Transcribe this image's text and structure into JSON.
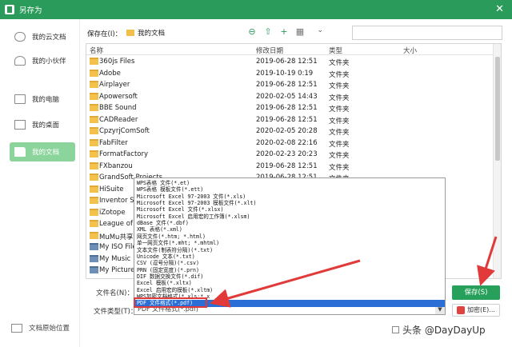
{
  "window": {
    "title": "另存为",
    "close_glyph": "✕"
  },
  "sidebar": {
    "items": [
      {
        "label": "我的云文档",
        "icon": "cloud-icon"
      },
      {
        "label": "我的小伙伴",
        "icon": "people-icon"
      },
      {
        "label": "我的电脑",
        "icon": "computer-icon"
      },
      {
        "label": "我的桌面",
        "icon": "desktop-icon"
      },
      {
        "label": "我的文档",
        "icon": "folder-icon",
        "active": true
      }
    ],
    "original_location": "文档原始位置"
  },
  "pathbar": {
    "label": "保存在(I)：",
    "location": "我的文档",
    "tools": [
      "back-icon",
      "up-folder-icon",
      "new-folder-icon",
      "view-menu-icon"
    ]
  },
  "list": {
    "columns": [
      "名称",
      "修改日期",
      "类型",
      "大小"
    ],
    "rows": [
      {
        "name": "360js Files",
        "date": "2019-06-28 12:51",
        "type": "文件夹"
      },
      {
        "name": "Adobe",
        "date": "2019-10-19 0:19",
        "type": "文件夹"
      },
      {
        "name": "Airplayer",
        "date": "2019-06-28 12:51",
        "type": "文件夹"
      },
      {
        "name": "Apowersoft",
        "date": "2020-02-05 14:43",
        "type": "文件夹"
      },
      {
        "name": "BBE Sound",
        "date": "2019-06-28 12:51",
        "type": "文件夹"
      },
      {
        "name": "CADReader",
        "date": "2019-06-28 12:51",
        "type": "文件夹"
      },
      {
        "name": "CpzyrjComSoft",
        "date": "2020-02-05 20:28",
        "type": "文件夹"
      },
      {
        "name": "FabFilter",
        "date": "2020-02-08 22:16",
        "type": "文件夹"
      },
      {
        "name": "FormatFactory",
        "date": "2020-02-23 20:23",
        "type": "文件夹"
      },
      {
        "name": "FXbanzou",
        "date": "2019-06-28 12:51",
        "type": "文件夹"
      },
      {
        "name": "GrandSoft Projects",
        "date": "2019-06-28 12:51",
        "type": "文件夹"
      },
      {
        "name": "HiSuite",
        "date": "",
        "type": ""
      },
      {
        "name": "Inventor Se",
        "date": "",
        "type": ""
      },
      {
        "name": "iZotope",
        "date": "",
        "type": ""
      },
      {
        "name": "League of L",
        "date": "",
        "type": ""
      },
      {
        "name": "MuMu共享文",
        "date": "",
        "type": ""
      },
      {
        "name": "My ISO File",
        "date": "",
        "type": "",
        "special": true
      },
      {
        "name": "My Music",
        "date": "",
        "type": "",
        "special": true
      },
      {
        "name": "My Pictures",
        "date": "",
        "type": "",
        "special": true
      }
    ]
  },
  "dropdown": {
    "options": [
      "WPS表格 文件(*.et)",
      "WPS表格 模板文件(*.ett)",
      "Microsoft Excel 97-2003 文件(*.xls)",
      "Microsoft Excel 97-2003 模板文件(*.xlt)",
      "Microsoft Excel 文件(*.xlsx)",
      "Microsoft Excel 启用宏的工作簿(*.xlsm)",
      "dBase 文件(*.dbf)",
      "XML 表格(*.xml)",
      "网页文件(*.htm; *.html)",
      "单一网页文件(*.mht; *.mhtml)",
      "文本文件(制表符分隔)(*.txt)",
      "Unicode 文本(*.txt)",
      "CSV (逗号分隔)(*.csv)",
      "PRN (固定宽度)(*.prn)",
      "DIF 数据交换文件(*.dif)",
      "Excel 模板(*.xltx)",
      "Excel 启用宏的模板(*.xltm)",
      "WPS加密文档格式(*.xls;*.x"
    ],
    "selected": "PDF 文件格式(*.pdf)"
  },
  "form": {
    "filename_label": "文件名(N)：",
    "filetype_label": "文件类型(T)：",
    "filetype_value": "PDF 文件格式(*.pdf)"
  },
  "buttons": {
    "save": "保存(S)",
    "encrypt": "加密(E)..."
  },
  "watermark": "头条 @DayDayUp",
  "colors": {
    "titlebar": "#2a9b5a",
    "active_sidebar": "#8bd49b",
    "save_button": "#26a05a",
    "selection": "#2b6fd6",
    "annotation": "#e23a3a"
  }
}
